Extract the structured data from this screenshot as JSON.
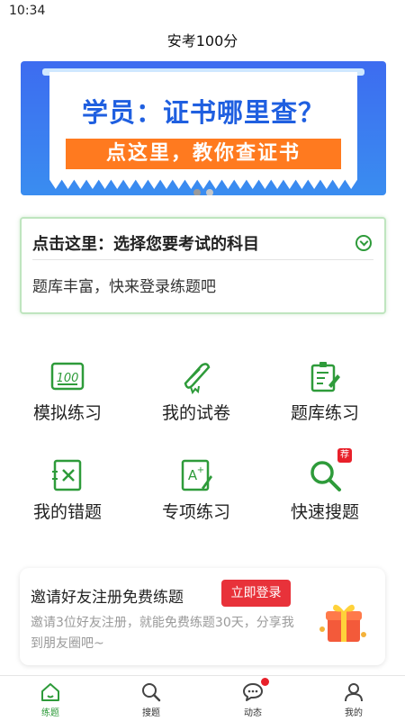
{
  "status_bar": {
    "time": "10:34"
  },
  "app": {
    "title": "安考100分"
  },
  "banner": {
    "headline": "学员：证书哪里查？",
    "cta": "点这里，教你查证书",
    "brand_color": "#3d6cf0",
    "cta_color": "#ff7a1f"
  },
  "subject_card": {
    "title": "点击这里：选择您要考试的科目",
    "description": "题库丰富，快来登录练题吧"
  },
  "features": [
    {
      "label": "模拟练习",
      "icon": "score-100-icon"
    },
    {
      "label": "我的试卷",
      "icon": "scroll-diploma-icon"
    },
    {
      "label": "题库练习",
      "icon": "notebook-pen-icon"
    },
    {
      "label": "我的错题",
      "icon": "wrong-answer-icon"
    },
    {
      "label": "专项练习",
      "icon": "grade-a-plus-icon"
    },
    {
      "label": "快速搜题",
      "icon": "search-icon",
      "badge": "荐"
    }
  ],
  "invite": {
    "title": "邀请好友注册免费练题",
    "button": "立即登录",
    "description": "邀请3位好友注册，就能免费练题30天，分享我到朋友圈吧~"
  },
  "tabs": [
    {
      "label": "练题",
      "icon": "home-icon",
      "active": true
    },
    {
      "label": "搜题",
      "icon": "search-icon",
      "active": false
    },
    {
      "label": "动态",
      "icon": "chat-bubble-icon",
      "active": false,
      "dot": true
    },
    {
      "label": "我的",
      "icon": "person-icon",
      "active": false
    }
  ],
  "colors": {
    "accent_green": "#2e9b3a",
    "alert_red": "#e8202a"
  }
}
